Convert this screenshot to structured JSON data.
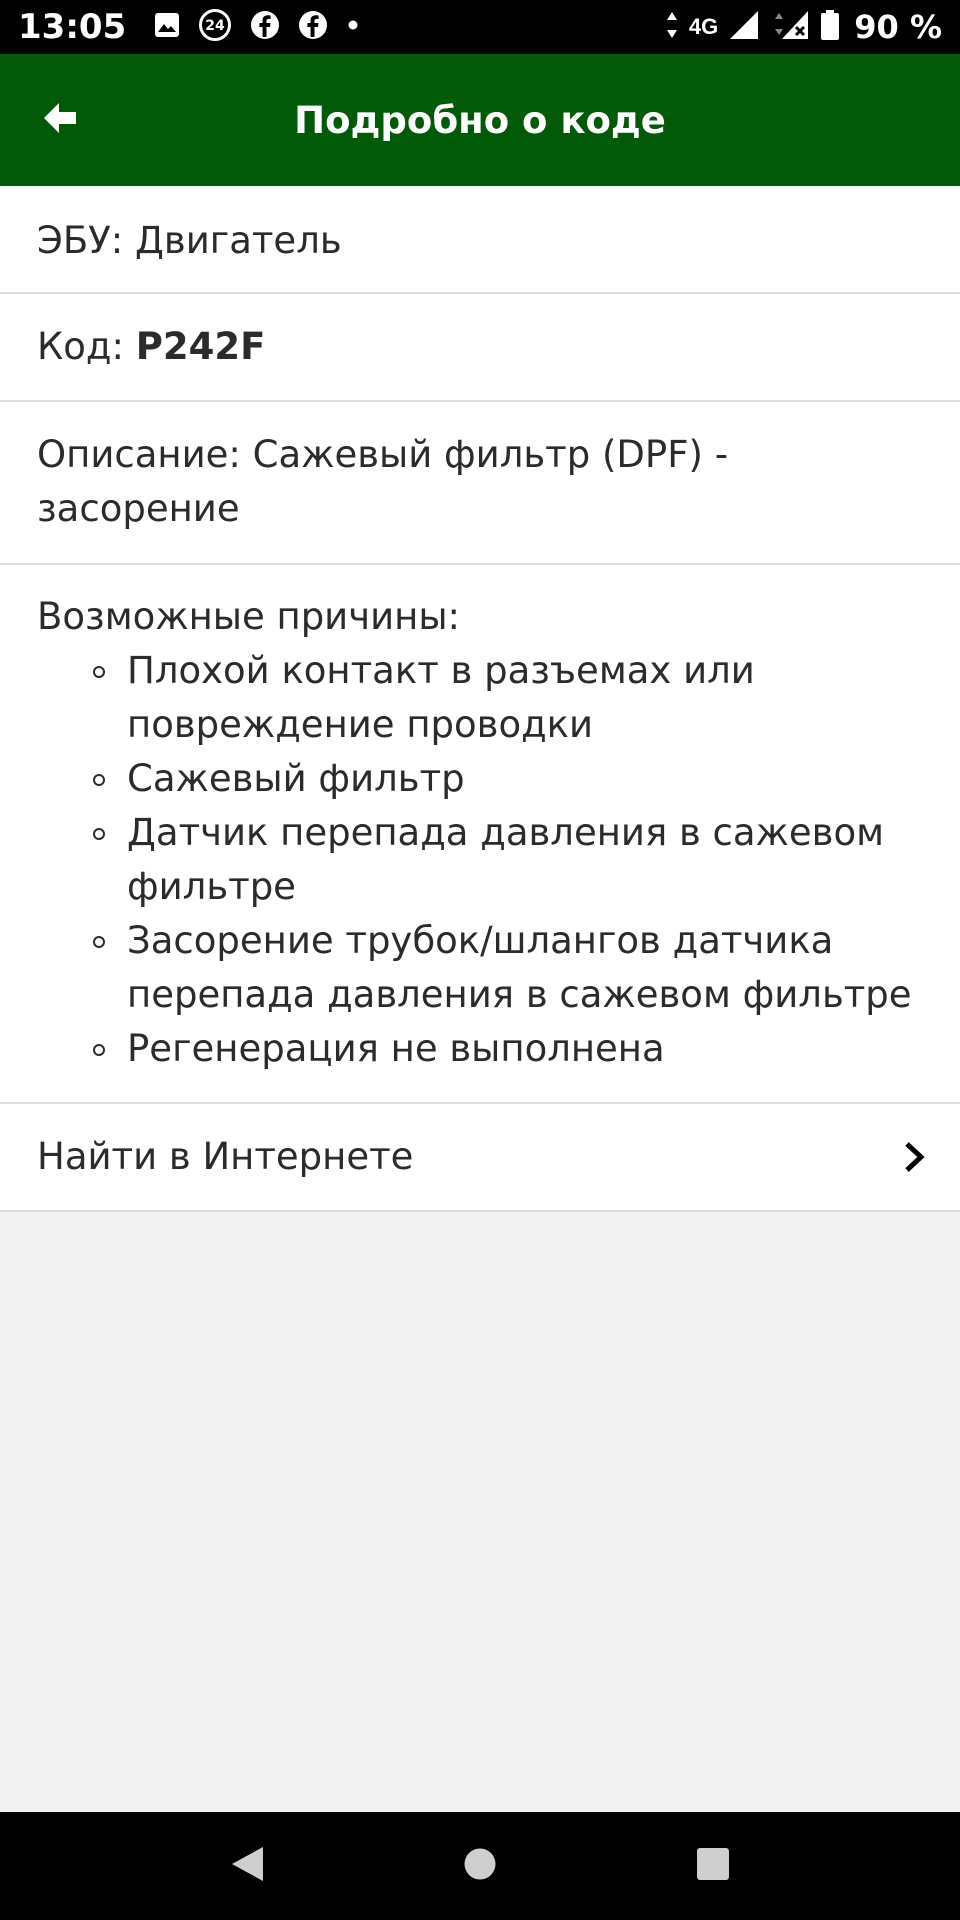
{
  "status_bar": {
    "time": "13:05",
    "network": "4G",
    "battery": "90 %",
    "icons_left": [
      "image-icon",
      "24-badge-icon",
      "facebook-icon",
      "facebook-icon",
      "dot-icon"
    ],
    "icons_right": [
      "data-arrows-icon",
      "signal-icon",
      "signal-x-icon",
      "battery-icon"
    ]
  },
  "app_bar": {
    "title": "Подробно о коде",
    "back_icon": "arrow-left-icon",
    "color": "#005a07"
  },
  "details": {
    "ecu_label": "ЭБУ:",
    "ecu_value": "Двигатель",
    "code_label": "Код:",
    "code_value": "P242F",
    "description_label": "Описание:",
    "description_value": "Сажевый фильтр (DPF) - засорение",
    "causes_label": "Возможные причины:",
    "causes": [
      "Плохой контакт в разъемах или повреждение проводки",
      "Сажевый фильтр",
      "Датчик перепада давления в сажевом фильтре",
      "Засорение трубок/шлангов датчика перепада давления в сажевом фильтре",
      "Регенерация не выполнена"
    ],
    "search_label": "Найти в Интернете",
    "search_icon": "chevron-right-icon"
  },
  "nav_bar": {
    "buttons": [
      "back-triangle-icon",
      "home-circle-icon",
      "recents-square-icon"
    ]
  }
}
